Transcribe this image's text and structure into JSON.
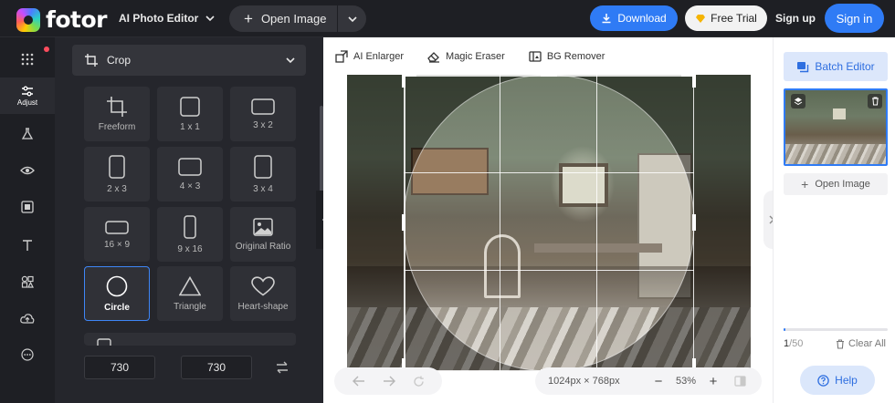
{
  "header": {
    "logo_text": "fotor",
    "app_switcher": "AI Photo Editor",
    "open_image": "Open Image",
    "download": "Download",
    "free_trial": "Free Trial",
    "sign_up": "Sign up",
    "sign_in": "Sign in"
  },
  "rail": {
    "active_label": "Adjust"
  },
  "panel": {
    "crop_label": "Crop",
    "presets": [
      {
        "label": "Freeform"
      },
      {
        "label": "1 x 1"
      },
      {
        "label": "3 x 2"
      },
      {
        "label": "2 x 3"
      },
      {
        "label": "4 × 3"
      },
      {
        "label": "3 x 4"
      },
      {
        "label": "16 × 9"
      },
      {
        "label": "9 x 16"
      },
      {
        "label": "Original Ratio"
      },
      {
        "label": "Circle"
      },
      {
        "label": "Triangle"
      },
      {
        "label": "Heart-shape"
      }
    ],
    "width_value": "730",
    "height_value": "730",
    "times": "×"
  },
  "canvas": {
    "tools": {
      "enlarger": "AI Enlarger",
      "eraser": "Magic Eraser",
      "bg_remover": "BG Remover"
    },
    "image_size": "1024px × 768px",
    "zoom": "53%",
    "zoom_minus": "−",
    "zoom_plus": "+"
  },
  "right_panel": {
    "batch_editor": "Batch Editor",
    "open_image": "Open Image",
    "count_current": "1",
    "count_total": "/50",
    "progress_fraction": 0.02,
    "clear_all": "Clear All",
    "help": "Help"
  },
  "colors": {
    "accent": "#2f7bf5",
    "dark_bg": "#1e1f24",
    "panel_bg": "#25262c"
  }
}
